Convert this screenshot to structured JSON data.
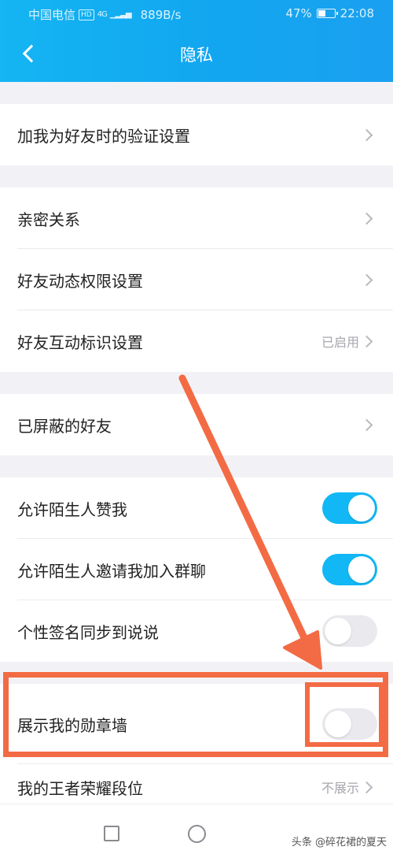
{
  "status_bar": {
    "carrier": "中国电信",
    "hd": "HD",
    "network": "4G",
    "speed": "889B/s",
    "battery": "47%",
    "battery_level": 0.47,
    "time": "22:08"
  },
  "nav": {
    "title": "隐私"
  },
  "rows": {
    "verify": {
      "label": "加我为好友时的验证设置"
    },
    "intimate": {
      "label": "亲密关系"
    },
    "feed_perm": {
      "label": "好友动态权限设置"
    },
    "interact_mark": {
      "label": "好友互动标识设置",
      "value": "已启用"
    },
    "blocked": {
      "label": "已屏蔽的好友"
    },
    "allow_like": {
      "label": "允许陌生人赞我",
      "on": true
    },
    "allow_invite": {
      "label": "允许陌生人邀请我加入群聊",
      "on": true
    },
    "sync_sign": {
      "label": "个性签名同步到说说",
      "on": false
    },
    "medal_wall": {
      "label": "展示我的勋章墙",
      "on": false
    },
    "king_rank": {
      "label": "我的王者荣耀段位",
      "value": "不展示"
    }
  },
  "watermark": "头条 @碎花裙的夏天",
  "colors": {
    "accent": "#12b7f5",
    "annotation": "#f36b44"
  }
}
